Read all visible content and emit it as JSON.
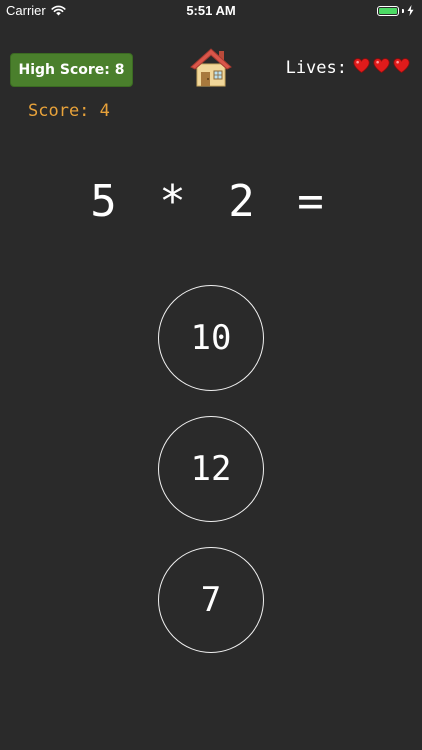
{
  "status_bar": {
    "carrier": "Carrier",
    "time": "5:51 AM",
    "battery_level": 1.0,
    "battery_color": "#4cd964"
  },
  "hud": {
    "high_score_label": "High Score: 8",
    "lives_label": "Lives:",
    "lives_count": 3,
    "score_label": "Score: 4",
    "home_icon": "house-icon",
    "heart_icon": "heart-icon"
  },
  "question": {
    "equation": "5 * 2 ="
  },
  "answers": [
    {
      "label": "10"
    },
    {
      "label": "12"
    },
    {
      "label": "7"
    }
  ],
  "colors": {
    "background": "#2a2a2a",
    "high_score_bg": "#4a7f2c",
    "score_text": "#e8a23a",
    "heart": "#e01b1b"
  }
}
